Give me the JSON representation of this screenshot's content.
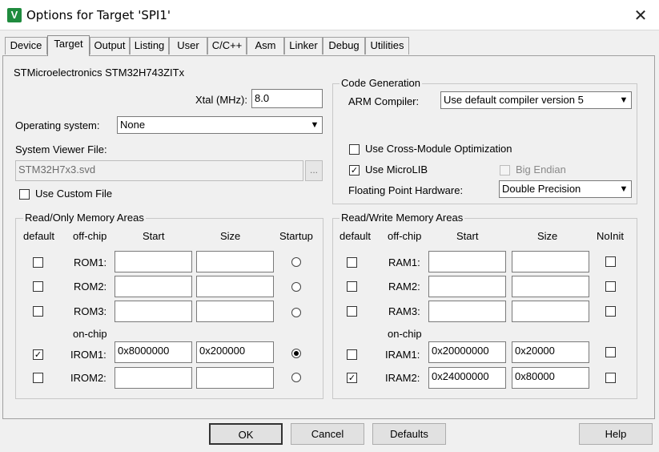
{
  "window": {
    "title": "Options for Target 'SPI1'",
    "close_label": "✕",
    "app_icon": "V"
  },
  "tabs": [
    "Device",
    "Target",
    "Output",
    "Listing",
    "User",
    "C/C++",
    "Asm",
    "Linker",
    "Debug",
    "Utilities"
  ],
  "active_tab": "Target",
  "device": {
    "name": "STMicroelectronics STM32H743ZITx"
  },
  "xtal": {
    "label": "Xtal (MHz):",
    "value": "8.0"
  },
  "os": {
    "label": "Operating system:",
    "value": "None"
  },
  "svd": {
    "label": "System Viewer File:",
    "value": "STM32H7x3.svd",
    "browse": "...",
    "custom_label": "Use Custom File",
    "custom_checked": false
  },
  "codegen": {
    "title": "Code Generation",
    "compiler_label": "ARM Compiler:",
    "compiler_value": "Use default compiler version 5",
    "cross_module_label": "Use Cross-Module Optimization",
    "cross_module_checked": false,
    "microlib_label": "Use MicroLIB",
    "microlib_checked": true,
    "big_endian_label": "Big Endian",
    "big_endian_checked": false,
    "fpu_label": "Floating Point Hardware:",
    "fpu_value": "Double Precision"
  },
  "ro_memory": {
    "title": "Read/Only Memory Areas",
    "headers": {
      "default": "default",
      "offchip": "off-chip",
      "start": "Start",
      "size": "Size",
      "startup": "Startup"
    },
    "onchip_label": "on-chip",
    "rows": [
      {
        "name": "ROM1:",
        "default": false,
        "start": "",
        "size": "",
        "startup": false
      },
      {
        "name": "ROM2:",
        "default": false,
        "start": "",
        "size": "",
        "startup": false
      },
      {
        "name": "ROM3:",
        "default": false,
        "start": "",
        "size": "",
        "startup": false
      },
      {
        "name": "IROM1:",
        "default": true,
        "start": "0x8000000",
        "size": "0x200000",
        "startup": true
      },
      {
        "name": "IROM2:",
        "default": false,
        "start": "",
        "size": "",
        "startup": false
      }
    ]
  },
  "rw_memory": {
    "title": "Read/Write Memory Areas",
    "headers": {
      "default": "default",
      "offchip": "off-chip",
      "start": "Start",
      "size": "Size",
      "noinit": "NoInit"
    },
    "onchip_label": "on-chip",
    "rows": [
      {
        "name": "RAM1:",
        "default": false,
        "start": "",
        "size": "",
        "noinit": false
      },
      {
        "name": "RAM2:",
        "default": false,
        "start": "",
        "size": "",
        "noinit": false
      },
      {
        "name": "RAM3:",
        "default": false,
        "start": "",
        "size": "",
        "noinit": false
      },
      {
        "name": "IRAM1:",
        "default": false,
        "start": "0x20000000",
        "size": "0x20000",
        "noinit": false
      },
      {
        "name": "IRAM2:",
        "default": true,
        "start": "0x24000000",
        "size": "0x80000",
        "noinit": false
      }
    ]
  },
  "buttons": {
    "ok": "OK",
    "cancel": "Cancel",
    "defaults": "Defaults",
    "help": "Help"
  },
  "icons": {
    "close": "close-icon",
    "app": "keil-uvision-icon",
    "dropdown": "chevron-down-icon"
  },
  "colors": {
    "title_bg": "#ffffff",
    "dialog_bg": "#f0f0f0",
    "app_icon": "#1f8b3e"
  }
}
